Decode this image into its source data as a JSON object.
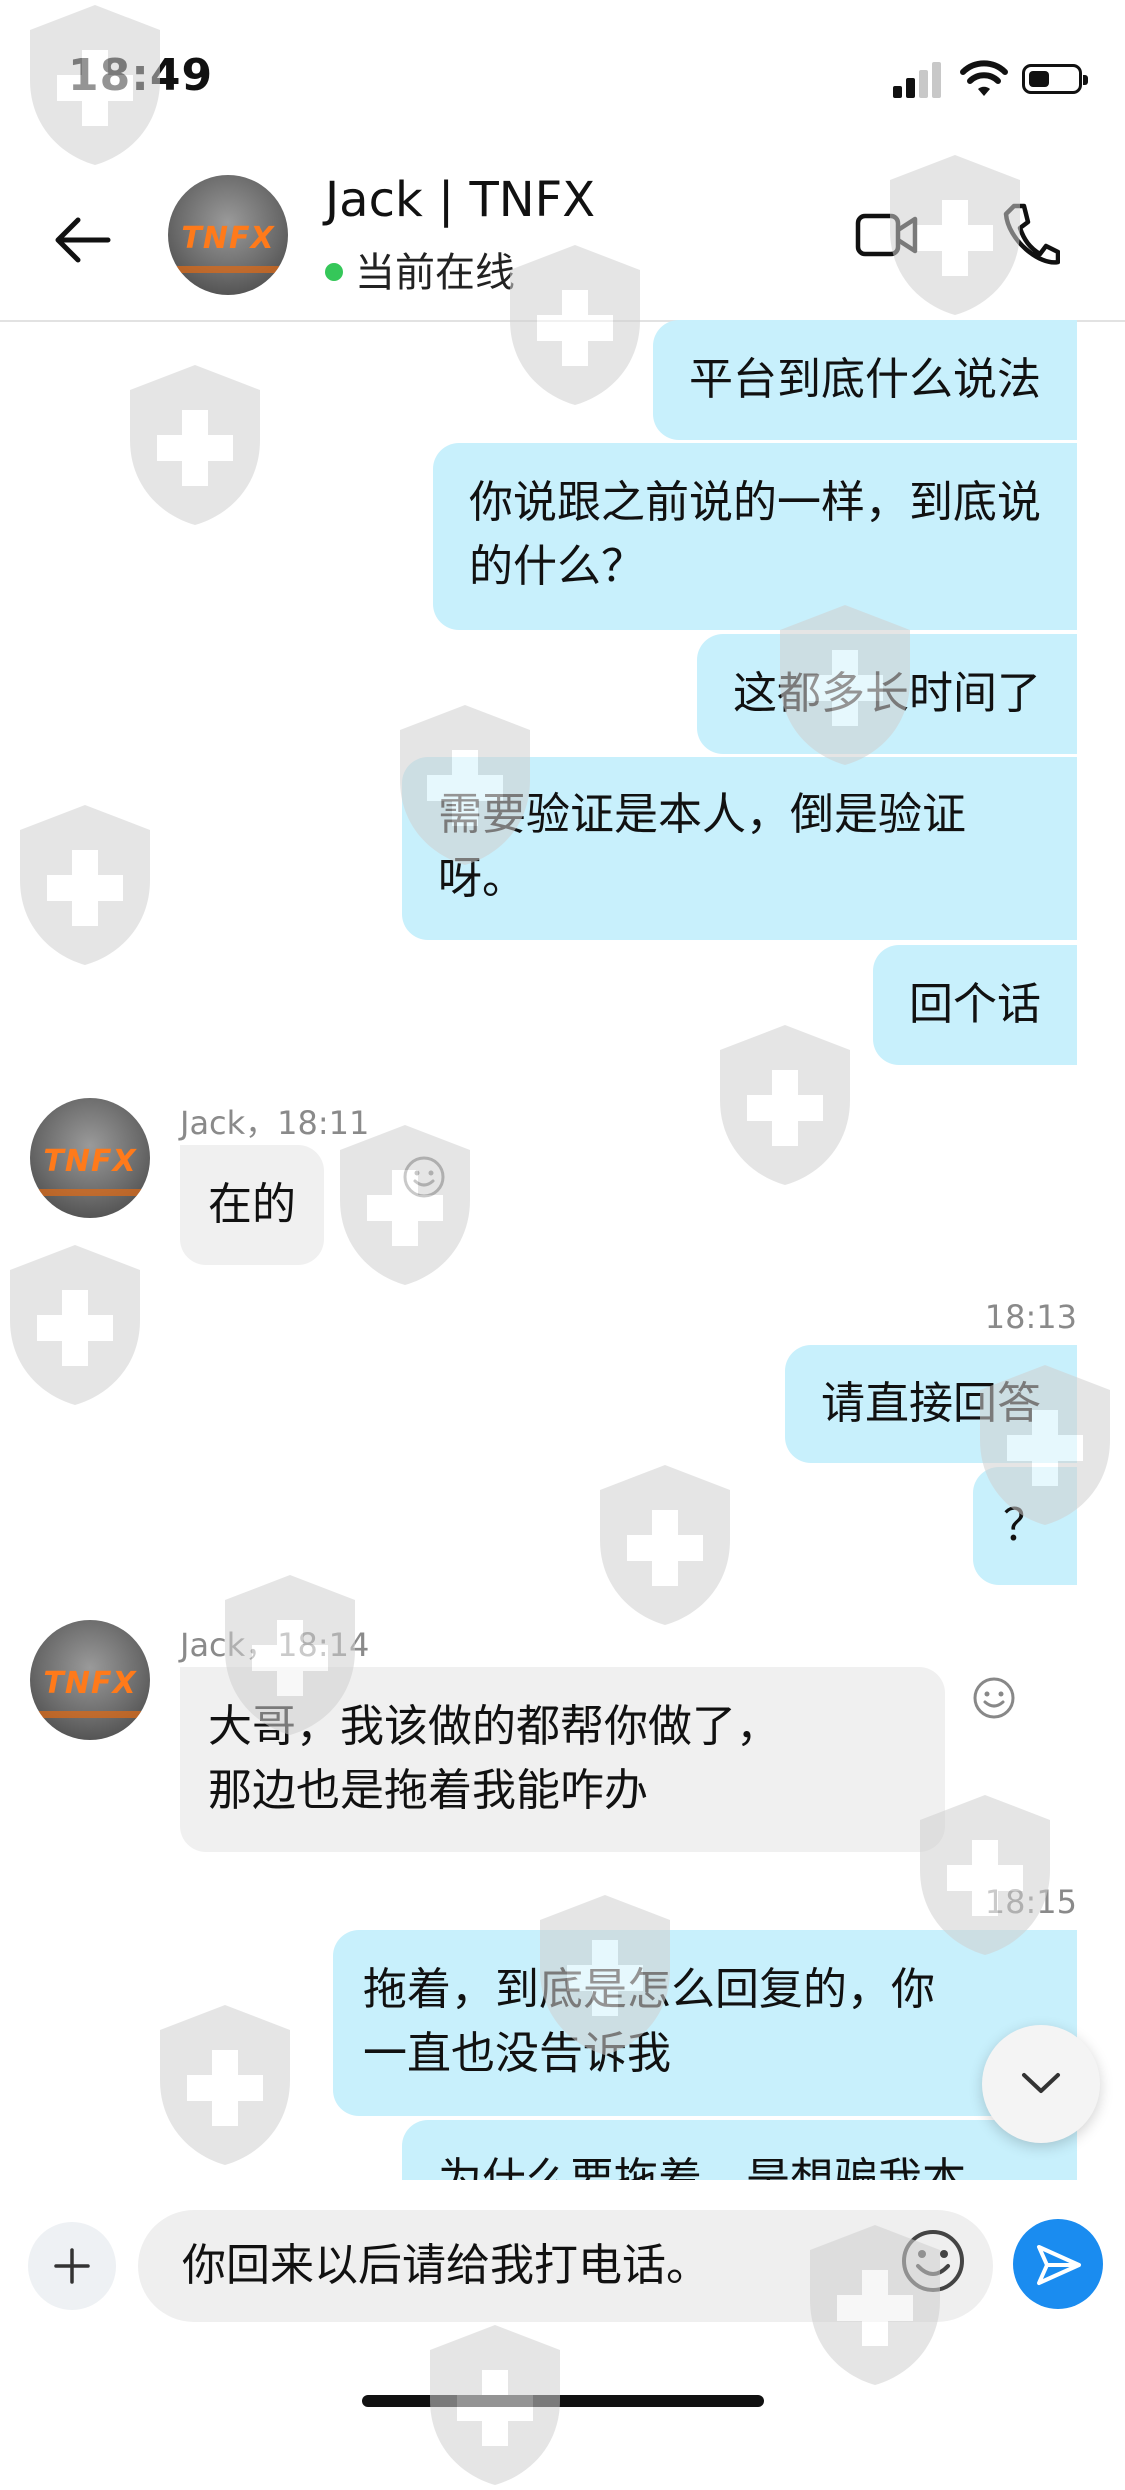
{
  "status_bar": {
    "time": "18:49"
  },
  "header": {
    "contact_name": "Jack | TNFX",
    "presence": "当前在线",
    "avatar_logo": "TNFX"
  },
  "messages": {
    "m1": "平台到底什么说法",
    "m2_l1": "你说跟之前说的一样，到底说",
    "m2_l2": "的什么？",
    "m3": "这都多长时间了",
    "m4_l1": "需要验证是本人，倒是验证",
    "m4_l2": "呀。",
    "m5": "回个话",
    "m6_meta": "Jack，18:11",
    "m6": "在的",
    "ts1": "18:13",
    "m7": "请直接回答",
    "m8": "？",
    "m9_meta": "Jack，18:14",
    "m9_l1": "大哥，我该做的都帮你做了，",
    "m9_l2": "那边也是拖着我能咋办",
    "ts2": "18:15",
    "m10_l1": "拖着，到底是怎么回复的，你",
    "m10_l2": "一直也没告诉我",
    "m11_partial": "为什么要拖着，是想骗我本"
  },
  "input_bar": {
    "text": "你回来以后请给我打电话。",
    "plus_icon": "plus-icon",
    "emoji_icon": "smiley-icon",
    "send_icon": "send-icon"
  },
  "colors": {
    "my_bubble": "#c8f0fc",
    "their_bubble": "#f0f0f0",
    "online_dot": "#35c759",
    "send_button": "#1a8cf0"
  }
}
